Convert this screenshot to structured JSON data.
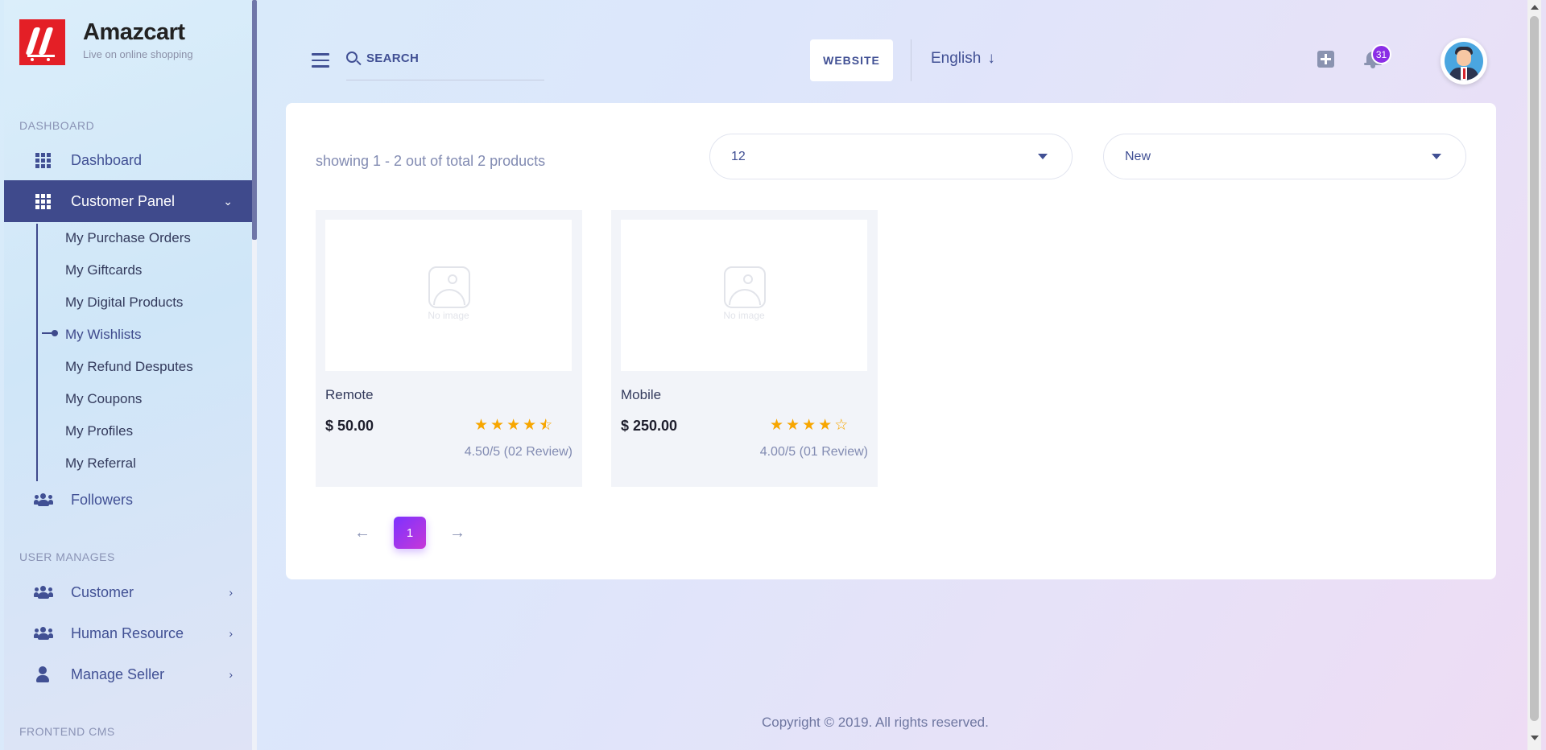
{
  "brand": {
    "name": "Amazcart",
    "tagline": "Live on online shopping"
  },
  "sidebar": {
    "sections": [
      "DASHBOARD",
      "USER MANAGES",
      "FRONTEND CMS"
    ],
    "dashboard": {
      "label": "Dashboard",
      "icon": "grid-icon"
    },
    "customer_panel": {
      "label": "Customer Panel",
      "icon": "grid-icon",
      "expanded": true
    },
    "sub_items": [
      "My Purchase Orders",
      "My Giftcards",
      "My Digital Products",
      "My Wishlists",
      "My Refund Desputes",
      "My Coupons",
      "My Profiles",
      "My Referral"
    ],
    "current_sub_item": "My Wishlists",
    "followers": {
      "label": "Followers",
      "icon": "users-icon"
    },
    "user_manages": [
      {
        "label": "Customer",
        "icon": "users-icon"
      },
      {
        "label": "Human Resource",
        "icon": "users-icon"
      },
      {
        "label": "Manage Seller",
        "icon": "user-icon"
      }
    ]
  },
  "header": {
    "search_placeholder": "SEARCH",
    "website_button": "WEBSITE",
    "language": "English",
    "notification_count": "31"
  },
  "listing": {
    "showing_text": "showing 1 - 2 out of total 2 products",
    "per_page": "12",
    "sort": "New"
  },
  "products": [
    {
      "name": "Remote",
      "price": "$ 50.00",
      "rating": 4.5,
      "review_text": "4.50/5 (02 Review)",
      "image_placeholder": "No image"
    },
    {
      "name": "Mobile",
      "price": "$ 250.00",
      "rating": 4.0,
      "review_text": "4.00/5 (01 Review)",
      "image_placeholder": "No image"
    }
  ],
  "pagination": {
    "current_page": "1",
    "prev": "←",
    "next": "→"
  },
  "footer": {
    "copyright": "Copyright © 2019. All rights reserved."
  },
  "colors": {
    "primary": "#415094",
    "active_nav": "#3f4a8c",
    "accent": "#7c32ff",
    "star": "#f7a600",
    "logo_red": "#e41f26"
  }
}
